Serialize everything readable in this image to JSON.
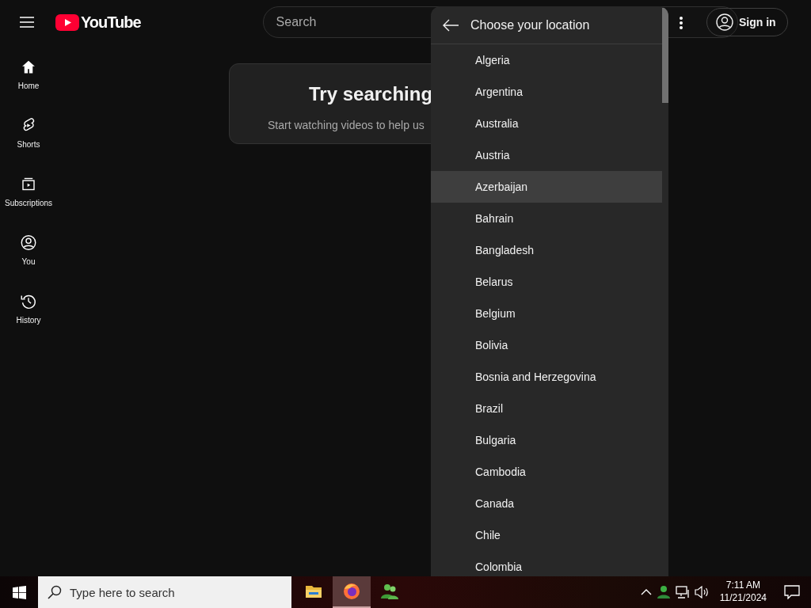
{
  "header": {
    "logo": "YouTube",
    "search": {
      "placeholder": "Search"
    },
    "sign_in": "Sign in"
  },
  "sidebar": {
    "items": [
      {
        "label": "Home"
      },
      {
        "label": "Shorts"
      },
      {
        "label": "Subscriptions"
      },
      {
        "label": "You"
      },
      {
        "label": "History"
      }
    ]
  },
  "prompt_card": {
    "title": "Try searching",
    "text": "Start watching videos to help us"
  },
  "location_menu": {
    "title": "Choose your location",
    "items": [
      {
        "label": "Algeria",
        "highlighted": false
      },
      {
        "label": "Argentina",
        "highlighted": false
      },
      {
        "label": "Australia",
        "highlighted": false
      },
      {
        "label": "Austria",
        "highlighted": false
      },
      {
        "label": "Azerbaijan",
        "highlighted": true
      },
      {
        "label": "Bahrain",
        "highlighted": false
      },
      {
        "label": "Bangladesh",
        "highlighted": false
      },
      {
        "label": "Belarus",
        "highlighted": false
      },
      {
        "label": "Belgium",
        "highlighted": false
      },
      {
        "label": "Bolivia",
        "highlighted": false
      },
      {
        "label": "Bosnia and Herzegovina",
        "highlighted": false
      },
      {
        "label": "Brazil",
        "highlighted": false
      },
      {
        "label": "Bulgaria",
        "highlighted": false
      },
      {
        "label": "Cambodia",
        "highlighted": false
      },
      {
        "label": "Canada",
        "highlighted": false
      },
      {
        "label": "Chile",
        "highlighted": false
      },
      {
        "label": "Colombia",
        "highlighted": false
      }
    ]
  },
  "taskbar": {
    "search": {
      "placeholder": "Type here to search"
    },
    "apps": [
      {
        "selected": false
      },
      {
        "selected": true
      },
      {
        "selected": false
      }
    ],
    "time": "7:11 AM",
    "date": "11/21/2024"
  }
}
